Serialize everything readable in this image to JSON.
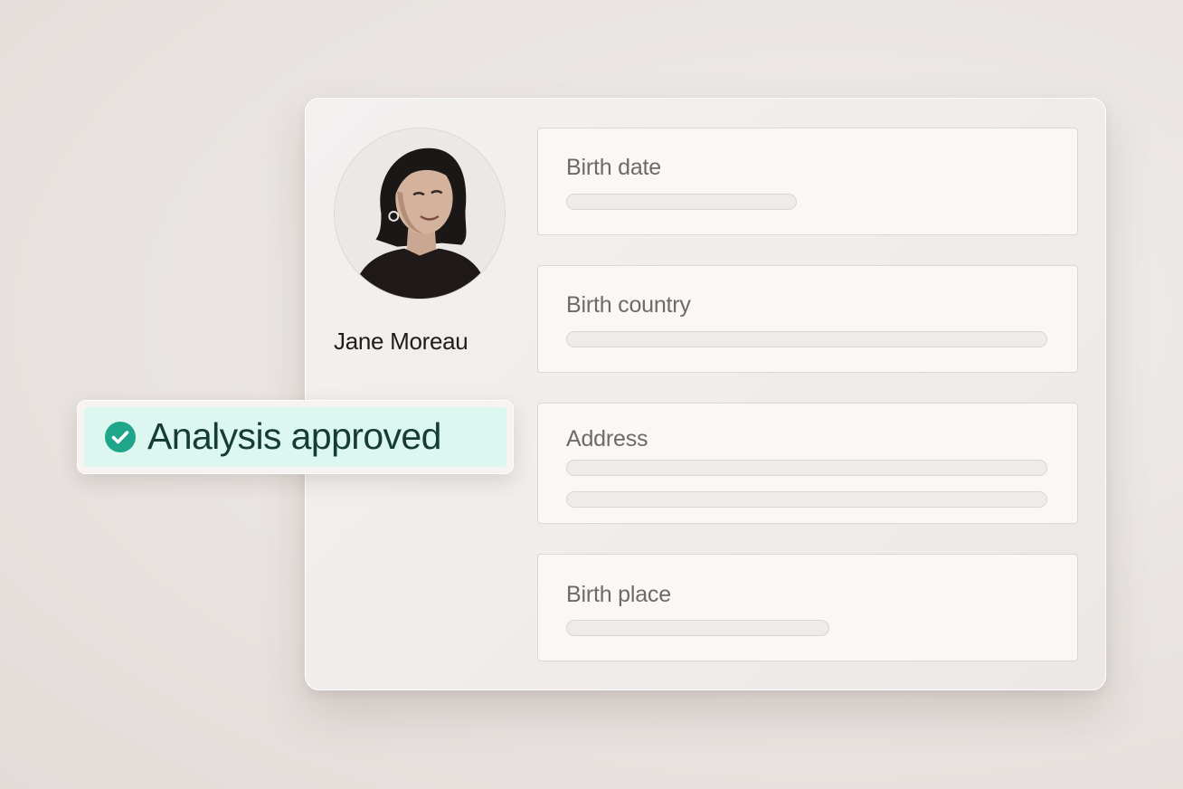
{
  "profile": {
    "name": "Jane Moreau",
    "avatar_icon": "person-portrait"
  },
  "fields": [
    {
      "label": "Birth date"
    },
    {
      "label": "Birth country"
    },
    {
      "label": "Address"
    },
    {
      "label": "Birth place"
    }
  ],
  "status": {
    "label": "Analysis approved",
    "icon": "check-circle-icon",
    "accent_color": "#1fa58a",
    "background_color": "#dcf6f0"
  }
}
